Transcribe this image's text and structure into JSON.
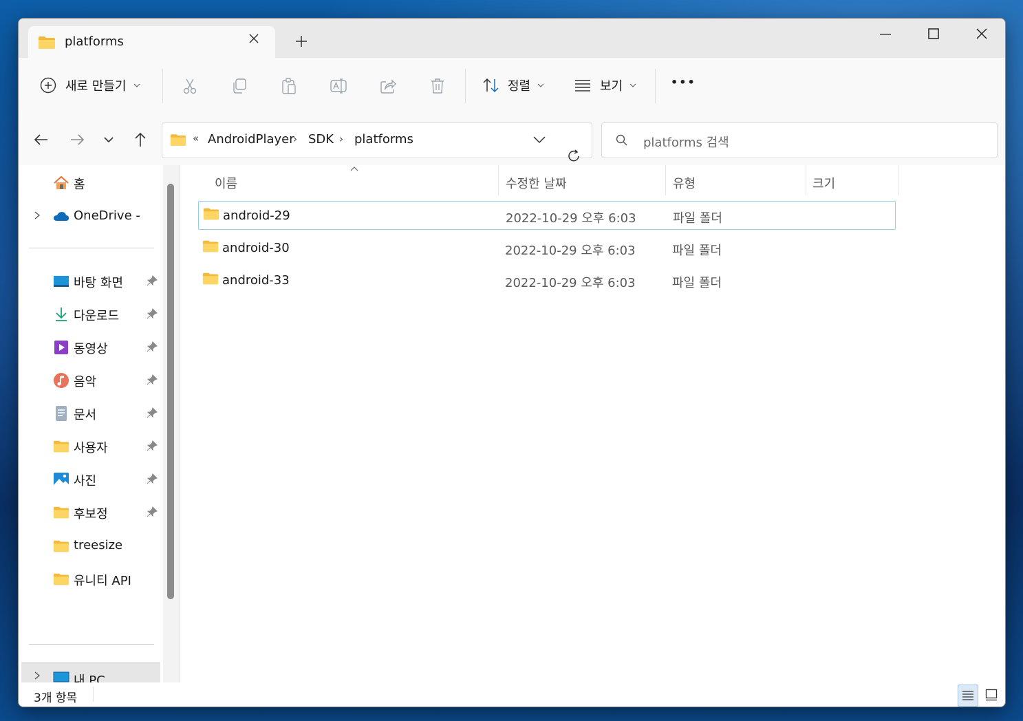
{
  "window": {
    "tab_title": "platforms",
    "new_tab_symbol": "+"
  },
  "commandbar": {
    "new_label": "새로 만들기",
    "sort_label": "정렬",
    "view_label": "보기",
    "more_label": "•••"
  },
  "address": {
    "overflow": "«",
    "crumbs": [
      "AndroidPlayer",
      "SDK",
      "platforms"
    ],
    "separator": "›"
  },
  "search": {
    "placeholder": "platforms 검색"
  },
  "sidebar": {
    "home": "홈",
    "onedrive": "OneDrive -",
    "quick_access": [
      {
        "label": "바탕 화면",
        "icon": "desktop-icon",
        "pinned": true
      },
      {
        "label": "다운로드",
        "icon": "download-icon",
        "pinned": true
      },
      {
        "label": "동영상",
        "icon": "video-icon",
        "pinned": true
      },
      {
        "label": "음악",
        "icon": "music-icon",
        "pinned": true
      },
      {
        "label": "문서",
        "icon": "document-icon",
        "pinned": true
      },
      {
        "label": "사용자",
        "icon": "folder-icon",
        "pinned": true
      },
      {
        "label": "사진",
        "icon": "pictures-icon",
        "pinned": true
      },
      {
        "label": "후보정",
        "icon": "folder-icon",
        "pinned": true
      },
      {
        "label": "treesize",
        "icon": "folder-icon",
        "pinned": false
      },
      {
        "label": "유니티 API",
        "icon": "folder-icon",
        "pinned": false
      }
    ],
    "this_pc": "내 PC"
  },
  "filelist": {
    "columns": [
      "이름",
      "수정한 날짜",
      "유형",
      "크기"
    ],
    "rows": [
      {
        "name": "android-29",
        "date": "2022-10-29 오후 6:03",
        "type": "파일 폴더",
        "size": "",
        "selected": true
      },
      {
        "name": "android-30",
        "date": "2022-10-29 오후 6:03",
        "type": "파일 폴더",
        "size": "",
        "selected": false
      },
      {
        "name": "android-33",
        "date": "2022-10-29 오후 6:03",
        "type": "파일 폴더",
        "size": "",
        "selected": false
      }
    ]
  },
  "status": {
    "item_count": "3개 항목"
  },
  "colors": {
    "folder_yellow": "#f8c642",
    "accent_blue": "#0f6cbd",
    "selection_border": "#8fd0e6"
  }
}
